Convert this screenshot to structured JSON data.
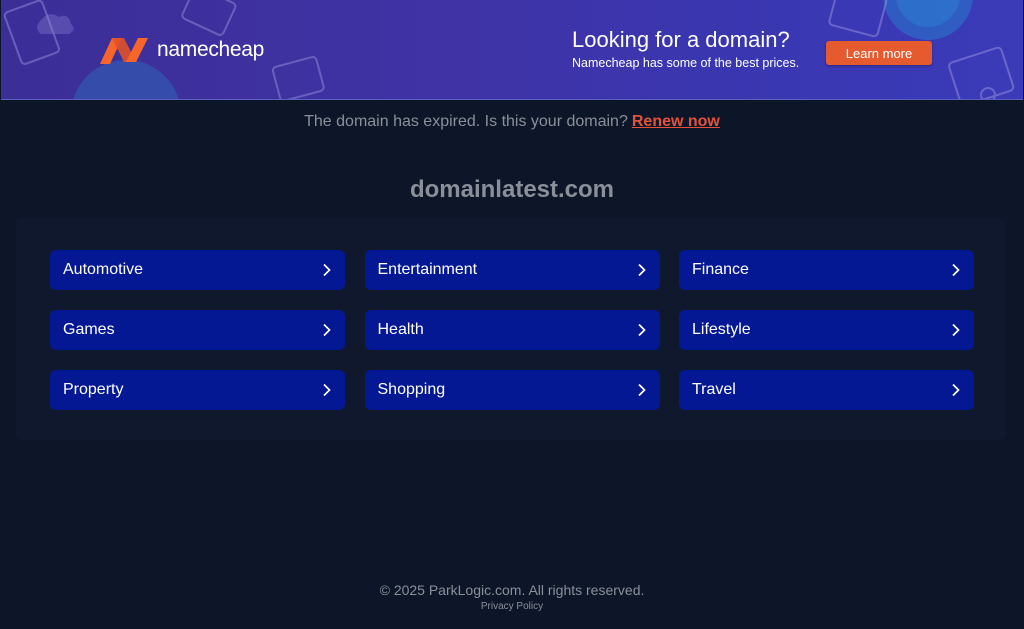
{
  "banner": {
    "brand": "namecheap",
    "title": "Looking for a domain?",
    "subtitle": "Namecheap has some of the best prices.",
    "button": "Learn more",
    "colors": {
      "brand_orange": "#f8652b",
      "button": "#e55a2f",
      "banner_bg": "#3f33a6"
    }
  },
  "notice": {
    "text": "The domain has expired. Is this your domain?",
    "link": "Renew now"
  },
  "domain": "domainlatest.com",
  "categories": [
    {
      "label": "Automotive",
      "icon": "chevron-right-icon"
    },
    {
      "label": "Entertainment",
      "icon": "chevron-right-icon"
    },
    {
      "label": "Finance",
      "icon": "chevron-right-icon"
    },
    {
      "label": "Games",
      "icon": "chevron-right-icon"
    },
    {
      "label": "Health",
      "icon": "chevron-right-icon"
    },
    {
      "label": "Lifestyle",
      "icon": "chevron-right-icon"
    },
    {
      "label": "Property",
      "icon": "chevron-right-icon"
    },
    {
      "label": "Shopping",
      "icon": "chevron-right-icon"
    },
    {
      "label": "Travel",
      "icon": "chevron-right-icon"
    }
  ],
  "footer": {
    "copyright": "© 2025 ParkLogic.com. All rights reserved.",
    "privacy": "Privacy Policy"
  },
  "colors": {
    "page_bg": "#0d1629",
    "category_bg": "#041894",
    "link": "#e3523a"
  }
}
